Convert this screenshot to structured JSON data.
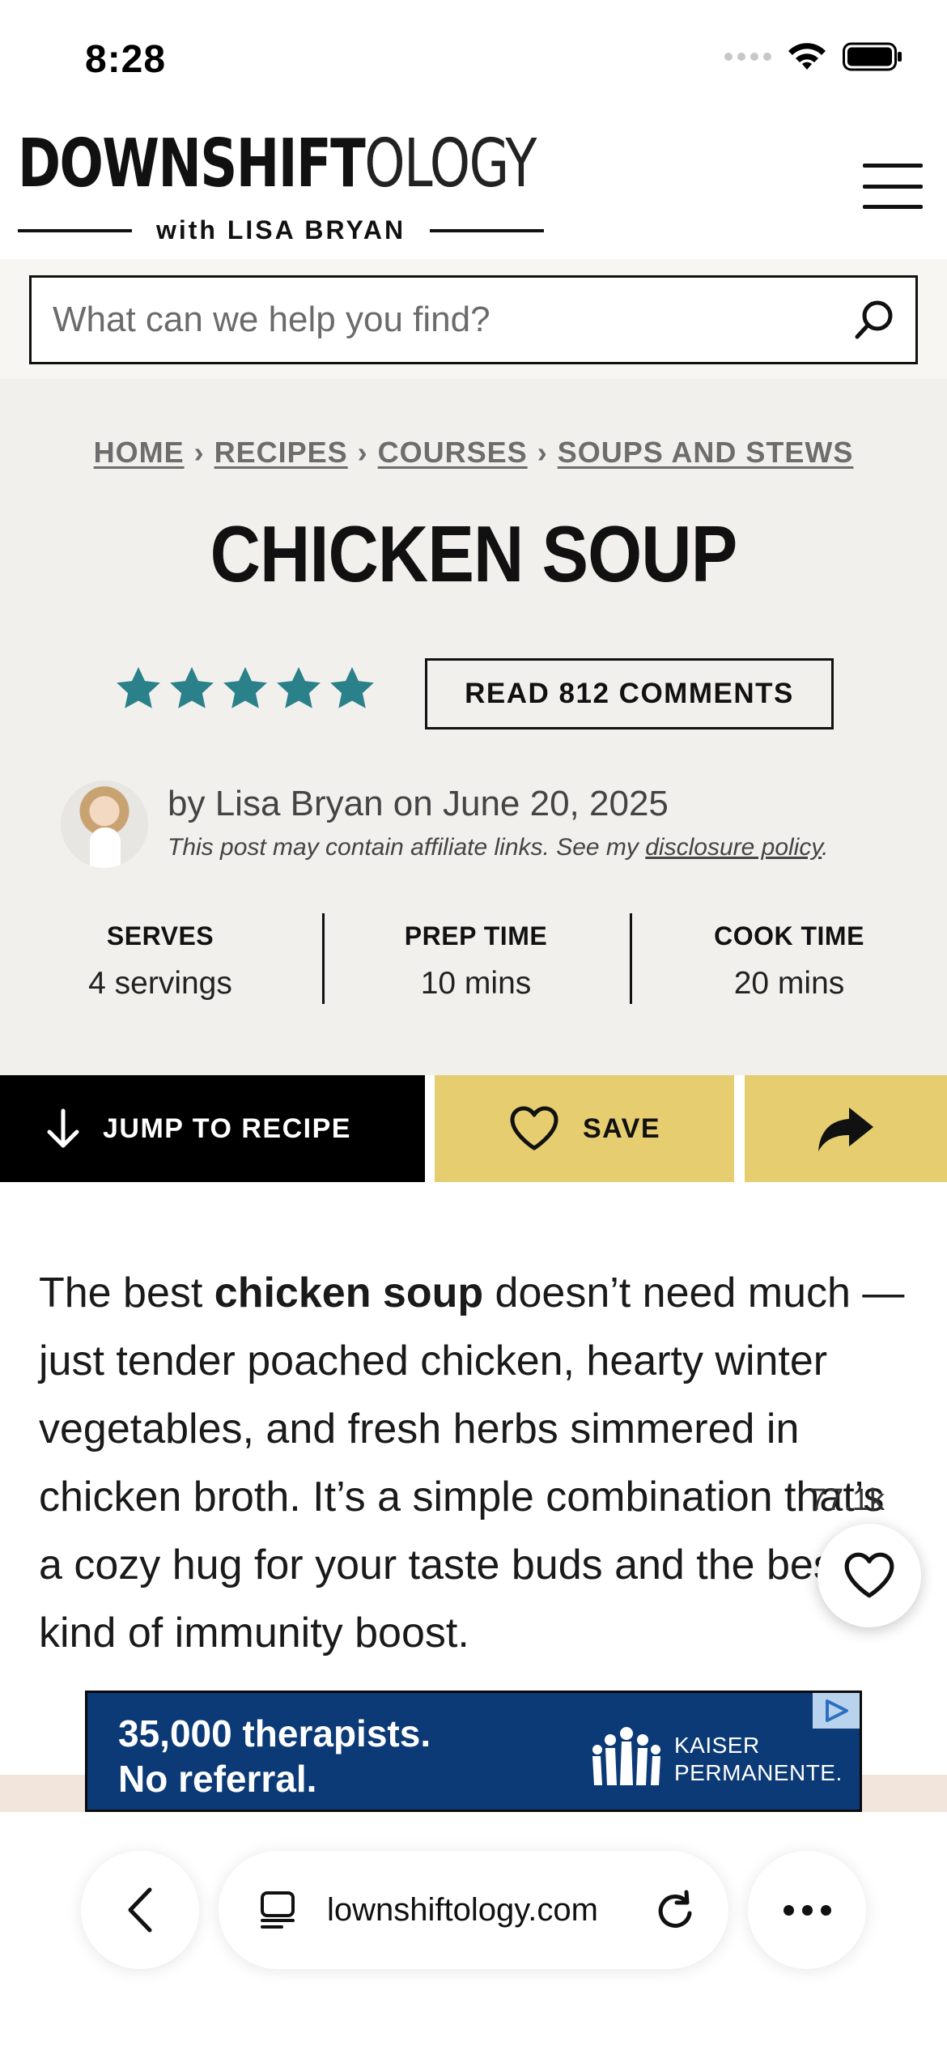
{
  "status": {
    "time": "8:28"
  },
  "header": {
    "logo_bold": "DOWNSHIFT",
    "logo_light": "OLOGY",
    "logo_sub": "with LISA BRYAN",
    "menu_icon": "hamburger-icon"
  },
  "search": {
    "placeholder": "What can we help you find?",
    "icon": "search-icon"
  },
  "breadcrumb": {
    "items": [
      "HOME",
      "RECIPES",
      "COURSES",
      "SOUPS AND STEWS"
    ],
    "separator": "›"
  },
  "recipe": {
    "title": "CHICKEN SOUP",
    "rating": 5,
    "rating_max": 5,
    "star_color": "#2a8189",
    "comments_label": "READ 812 COMMENTS",
    "byline": "by Lisa Bryan on June 20, 2025",
    "disclaimer_prefix": "This post may contain affiliate links. See my ",
    "disclaimer_link": "disclosure policy",
    "disclaimer_suffix": ".",
    "meta": [
      {
        "label": "SERVES",
        "value": "4 servings"
      },
      {
        "label": "PREP TIME",
        "value": "10 mins"
      },
      {
        "label": "COOK TIME",
        "value": "20 mins"
      }
    ]
  },
  "actions": {
    "jump_label": "JUMP TO RECIPE",
    "save_label": "SAVE",
    "accent_color": "#e5cd70"
  },
  "intro": {
    "p1_before": "The best ",
    "p1_bold": "chicken soup",
    "p1_after": " doesn’t need much — just tender poached chicken, hearty winter vegetables, and fresh herbs simmered in chicken broth. It’s a simple combination that’s a cozy hug for your taste buds and the best kind of immunity boost."
  },
  "favorite": {
    "count": "77.1k"
  },
  "ad": {
    "headline_line1": "35,000 therapists.",
    "headline_line2": "No referral.",
    "brand_line1": "KAISER",
    "brand_line2": "PERMANENTE."
  },
  "browser": {
    "url": "lownshiftology.com"
  }
}
